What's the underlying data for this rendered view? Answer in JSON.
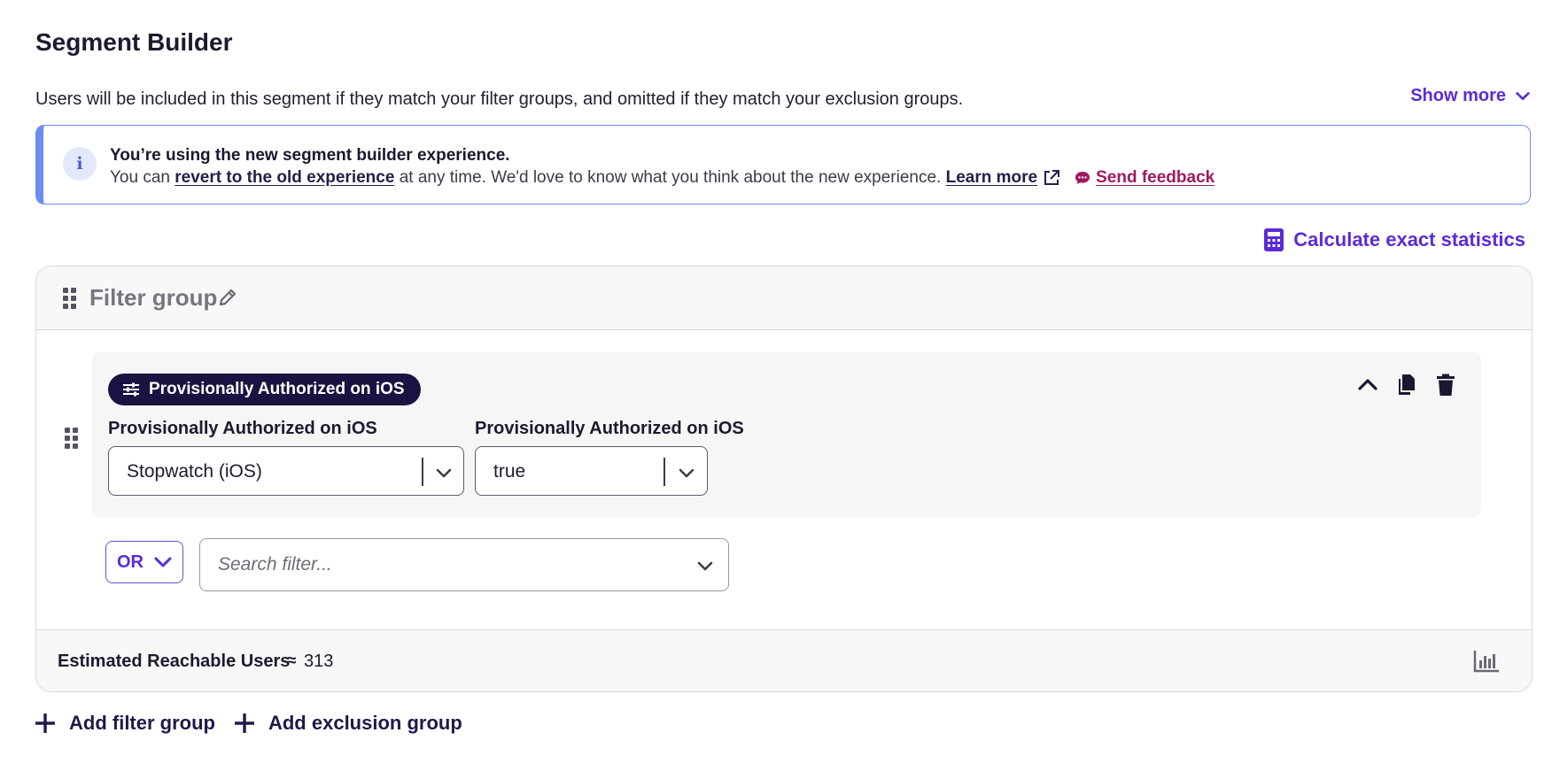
{
  "header": {
    "title": "Segment Builder",
    "description": "Users will be included in this segment if they match your filter groups, and omitted if they match your exclusion groups.",
    "show_more_label": "Show more"
  },
  "banner": {
    "title": "You’re using the new segment builder experience.",
    "body_prefix": "You can",
    "revert_link": "revert to the old experience",
    "body_suffix": "at any time. We'd love to know what you think about the new experience.",
    "learn_more_link": "Learn more",
    "send_feedback_link": "Send feedback",
    "icon": "info-icon"
  },
  "calculate": {
    "label": "Calculate exact statistics",
    "icon": "calculator-icon"
  },
  "filter_group": {
    "title": "Filter group",
    "filter": {
      "chip_label": "Provisionally Authorized on iOS",
      "field1_label": "Provisionally Authorized on iOS",
      "field1_value": "Stopwatch (iOS)",
      "field2_label": "Provisionally Authorized on iOS",
      "field2_value": "true"
    },
    "connector": "OR",
    "search_placeholder": "Search filter...",
    "estimate_label": "Estimated Reachable Users",
    "estimate_approx": "≈",
    "estimate_value": "313"
  },
  "actions": {
    "add_filter_group": "Add filter group",
    "add_exclusion_group": "Add exclusion group"
  },
  "colors": {
    "accent": "#5b2bd9",
    "chip_bg": "#1a1240",
    "feedback": "#a0195f",
    "banner_border": "#6e8cf0"
  }
}
